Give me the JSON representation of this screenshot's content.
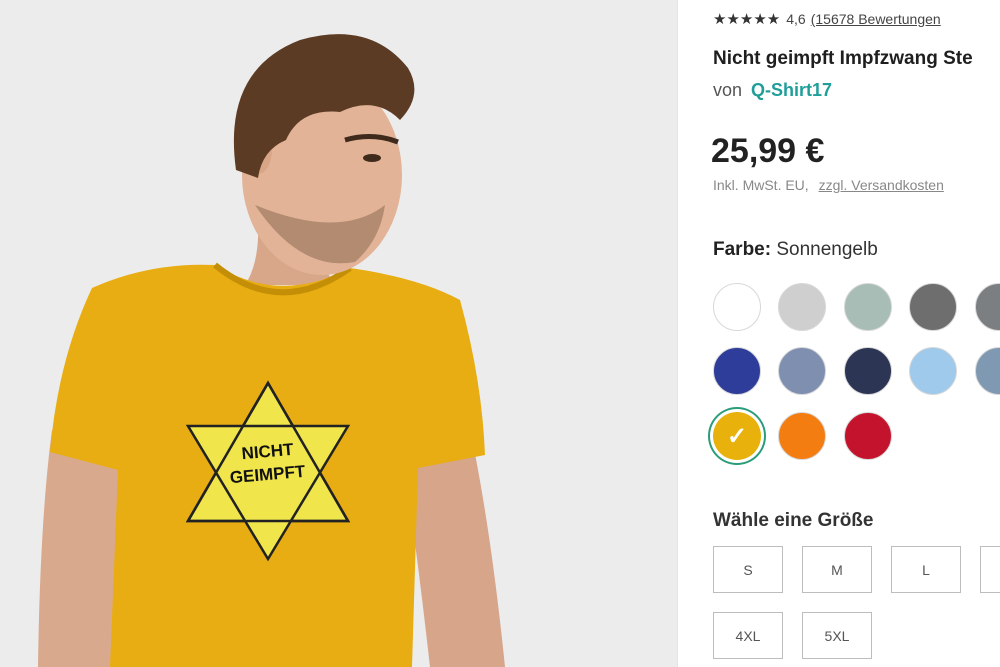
{
  "product": {
    "stars": "★★★★★",
    "rating_value": "4,6",
    "rating_count": "(15678 Bewertungen",
    "title": "Nicht geimpft Impfzwang Ste",
    "by_prefix": "von",
    "seller": "Q-Shirt17",
    "price": "25,99 €",
    "tax_note": "Inkl. MwSt. EU,",
    "shipping_link": "zzgl. Versandkosten",
    "shirt_print_line1": "NICHT",
    "shirt_print_line2": "GEIMPFT"
  },
  "color": {
    "label_key": "Farbe:",
    "label_value": "Sonnengelb",
    "swatches": [
      {
        "name": "white",
        "hex": "#ffffff"
      },
      {
        "name": "heather-light-grey",
        "hex": "#cfcfcf"
      },
      {
        "name": "sage-grey",
        "hex": "#a8bdb6"
      },
      {
        "name": "dark-grey",
        "hex": "#6e6e6e"
      },
      {
        "name": "charcoal",
        "hex": "#7b7f82"
      },
      {
        "name": "royal-blue",
        "hex": "#2e3c9a"
      },
      {
        "name": "heather-blue",
        "hex": "#7f8fb0"
      },
      {
        "name": "navy",
        "hex": "#2d3554"
      },
      {
        "name": "light-blue",
        "hex": "#9fcaeb"
      },
      {
        "name": "steel-blue",
        "hex": "#7f99b3"
      },
      {
        "name": "sunflower-yellow",
        "hex": "#e8b10b",
        "selected": true
      },
      {
        "name": "orange",
        "hex": "#f47d12"
      },
      {
        "name": "red",
        "hex": "#c4142d"
      }
    ]
  },
  "size": {
    "label": "Wähle eine Größe",
    "options": [
      "S",
      "M",
      "L",
      "",
      "4XL",
      "5XL"
    ]
  },
  "colors": {
    "accent_teal": "#1f9e9a",
    "selected_ring": "#2a9d7a",
    "shirt_yellow": "#e8ad12",
    "star_print": "#f0e54a"
  }
}
